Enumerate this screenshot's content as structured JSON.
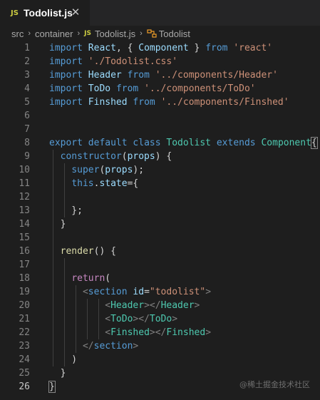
{
  "tab": {
    "badge": "JS",
    "title": "Todolist.js",
    "close": "✕"
  },
  "breadcrumb": {
    "items": [
      "src",
      "container",
      "Todolist.js",
      "Todolist"
    ],
    "separator": "›",
    "js_badge": "JS"
  },
  "editor": {
    "line_numbers": [
      "1",
      "2",
      "3",
      "4",
      "5",
      "6",
      "7",
      "8",
      "9",
      "10",
      "11",
      "12",
      "13",
      "14",
      "15",
      "16",
      "17",
      "18",
      "19",
      "20",
      "21",
      "22",
      "23",
      "24",
      "25",
      "26"
    ],
    "lines": [
      [
        [
          "kw",
          "import"
        ],
        [
          "pun",
          " "
        ],
        [
          "var",
          "React"
        ],
        [
          "pun",
          ", { "
        ],
        [
          "var",
          "Component"
        ],
        [
          "pun",
          " } "
        ],
        [
          "kw",
          "from"
        ],
        [
          "pun",
          " "
        ],
        [
          "str",
          "'react'"
        ]
      ],
      [
        [
          "kw",
          "import"
        ],
        [
          "pun",
          " "
        ],
        [
          "str",
          "'./Todolist.css'"
        ]
      ],
      [
        [
          "kw",
          "import"
        ],
        [
          "pun",
          " "
        ],
        [
          "var",
          "Header"
        ],
        [
          "pun",
          " "
        ],
        [
          "kw",
          "from"
        ],
        [
          "pun",
          " "
        ],
        [
          "str",
          "'../components/Header'"
        ]
      ],
      [
        [
          "kw",
          "import"
        ],
        [
          "pun",
          " "
        ],
        [
          "var",
          "ToDo"
        ],
        [
          "pun",
          " "
        ],
        [
          "kw",
          "from"
        ],
        [
          "pun",
          " "
        ],
        [
          "str",
          "'../components/ToDo'"
        ]
      ],
      [
        [
          "kw",
          "import"
        ],
        [
          "pun",
          " "
        ],
        [
          "var",
          "Finshed"
        ],
        [
          "pun",
          " "
        ],
        [
          "kw",
          "from"
        ],
        [
          "pun",
          " "
        ],
        [
          "str",
          "'../components/Finshed'"
        ]
      ],
      [],
      [],
      [
        [
          "kw",
          "export"
        ],
        [
          "pun",
          " "
        ],
        [
          "kw",
          "default"
        ],
        [
          "pun",
          " "
        ],
        [
          "kw",
          "class"
        ],
        [
          "pun",
          " "
        ],
        [
          "cls",
          "Todolist"
        ],
        [
          "pun",
          " "
        ],
        [
          "kw",
          "extends"
        ],
        [
          "pun",
          " "
        ],
        [
          "cls",
          "Component"
        ],
        [
          "hl",
          "{"
        ]
      ],
      [
        [
          "pun",
          "  "
        ],
        [
          "kw",
          "constructor"
        ],
        [
          "pun",
          "("
        ],
        [
          "var",
          "props"
        ],
        [
          "pun",
          ") {"
        ]
      ],
      [
        [
          "pun",
          "    "
        ],
        [
          "kw",
          "super"
        ],
        [
          "pun",
          "("
        ],
        [
          "var",
          "props"
        ],
        [
          "pun",
          ");"
        ]
      ],
      [
        [
          "pun",
          "    "
        ],
        [
          "kw",
          "this"
        ],
        [
          "pun",
          "."
        ],
        [
          "var",
          "state"
        ],
        [
          "pun",
          "={"
        ]
      ],
      [],
      [
        [
          "pun",
          "    };"
        ]
      ],
      [
        [
          "pun",
          "  }"
        ]
      ],
      [],
      [
        [
          "pun",
          "  "
        ],
        [
          "fn",
          "render"
        ],
        [
          "pun",
          "() {"
        ]
      ],
      [],
      [
        [
          "pun",
          "    "
        ],
        [
          "ctl",
          "return"
        ],
        [
          "pun",
          "("
        ]
      ],
      [
        [
          "pun",
          "      "
        ],
        [
          "tagb",
          "<"
        ],
        [
          "kw",
          "section"
        ],
        [
          "pun",
          " "
        ],
        [
          "attr",
          "id"
        ],
        [
          "pun",
          "="
        ],
        [
          "str",
          "\"todolist\""
        ],
        [
          "tagb",
          ">"
        ]
      ],
      [
        [
          "pun",
          "          "
        ],
        [
          "tagb",
          "<"
        ],
        [
          "tag",
          "Header"
        ],
        [
          "tagb",
          "></"
        ],
        [
          "tag",
          "Header"
        ],
        [
          "tagb",
          ">"
        ]
      ],
      [
        [
          "pun",
          "          "
        ],
        [
          "tagb",
          "<"
        ],
        [
          "tag",
          "ToDo"
        ],
        [
          "tagb",
          "></"
        ],
        [
          "tag",
          "ToDo"
        ],
        [
          "tagb",
          ">"
        ]
      ],
      [
        [
          "pun",
          "          "
        ],
        [
          "tagb",
          "<"
        ],
        [
          "tag",
          "Finshed"
        ],
        [
          "tagb",
          "></"
        ],
        [
          "tag",
          "Finshed"
        ],
        [
          "tagb",
          ">"
        ]
      ],
      [
        [
          "pun",
          "      "
        ],
        [
          "tagb",
          "</"
        ],
        [
          "kw",
          "section"
        ],
        [
          "tagb",
          ">"
        ]
      ],
      [
        [
          "pun",
          "    )"
        ]
      ],
      [
        [
          "pun",
          "  }"
        ]
      ],
      [
        [
          "hl",
          "}"
        ]
      ]
    ],
    "active_line": 26
  },
  "watermark": "@稀土掘金技术社区",
  "colors": {
    "background": "#1e1e1e",
    "keyword": "#569cd6",
    "control": "#c586c0",
    "class": "#4ec9b0",
    "variable": "#9cdcfe",
    "string": "#ce9178",
    "function": "#dcdcaa"
  }
}
